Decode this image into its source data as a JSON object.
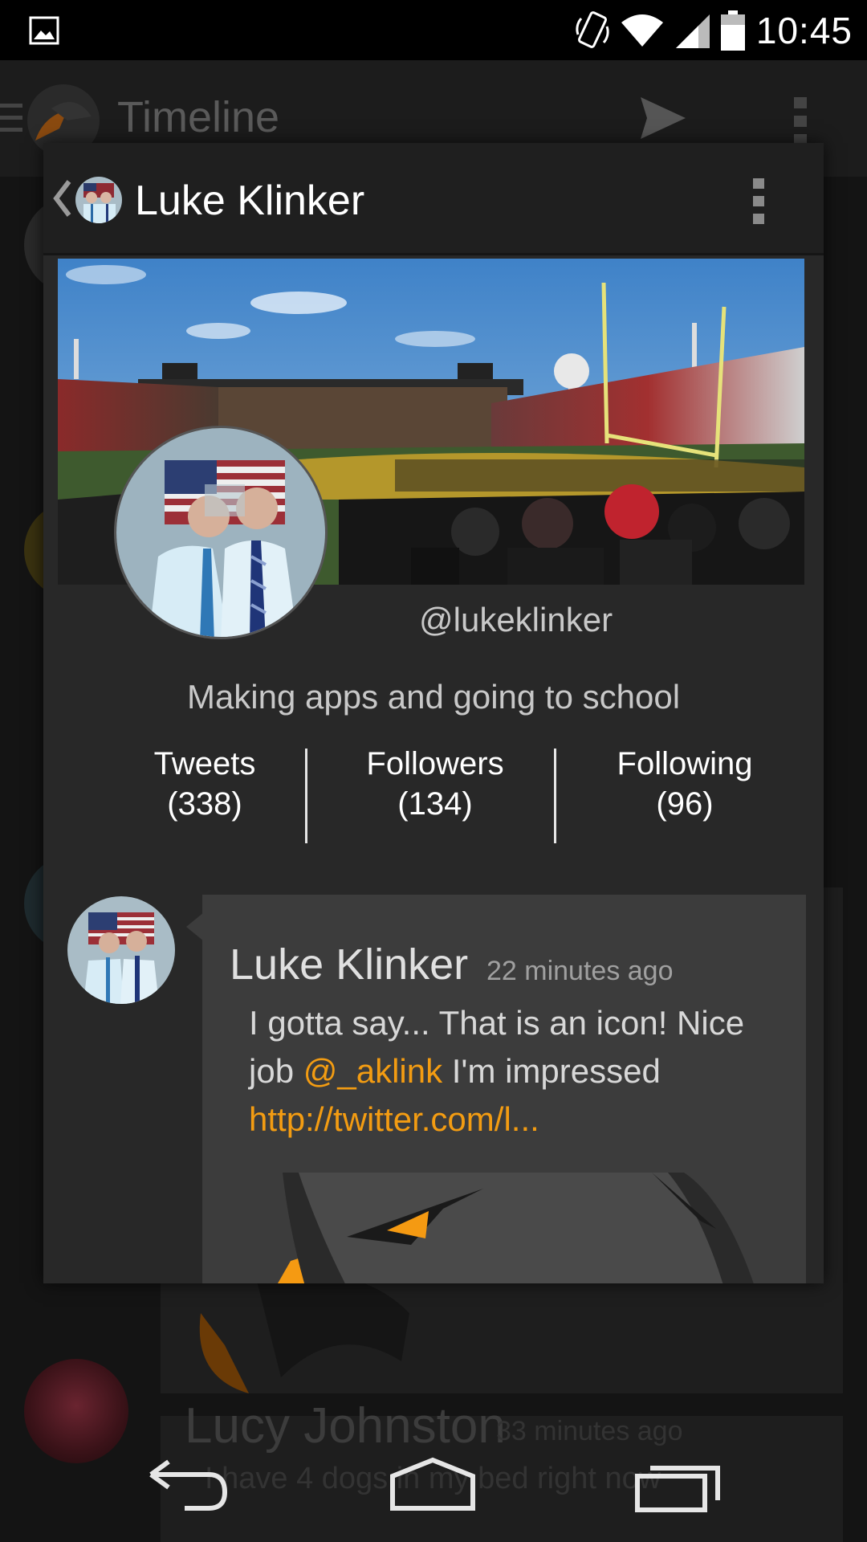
{
  "status_bar": {
    "time": "10:45",
    "icons": [
      "gallery-icon",
      "rotate-icon",
      "wifi-icon",
      "signal-icon",
      "battery-icon"
    ]
  },
  "background": {
    "toolbar_title": "Timeline",
    "peek_tweet_name": "Lucy Johnston",
    "peek_tweet_time": "33 minutes ago",
    "peek_tweet_text": "I have 4 dogs in my bed right now"
  },
  "profile": {
    "name": "Luke Klinker",
    "handle": "@lukeklinker",
    "bio": "Making apps and going to school",
    "stats": [
      {
        "label": "Tweets",
        "count": "(338)"
      },
      {
        "label": "Followers",
        "count": "(134)"
      },
      {
        "label": "Following",
        "count": "(96)"
      }
    ]
  },
  "tweet": {
    "name": "Luke Klinker",
    "time": "22 minutes ago",
    "text_1": "I gotta say... That is an icon! Nice job ",
    "mention": "@_aklink",
    "text_2": " I'm impressed ",
    "url": "http://twitter.com/l..."
  },
  "colors": {
    "accent": "#f39c12",
    "dialog_bg": "#282828",
    "card_bg": "#3c3c3c"
  },
  "nav_bar": {
    "icons": [
      "back-icon",
      "home-icon",
      "recents-icon"
    ]
  }
}
